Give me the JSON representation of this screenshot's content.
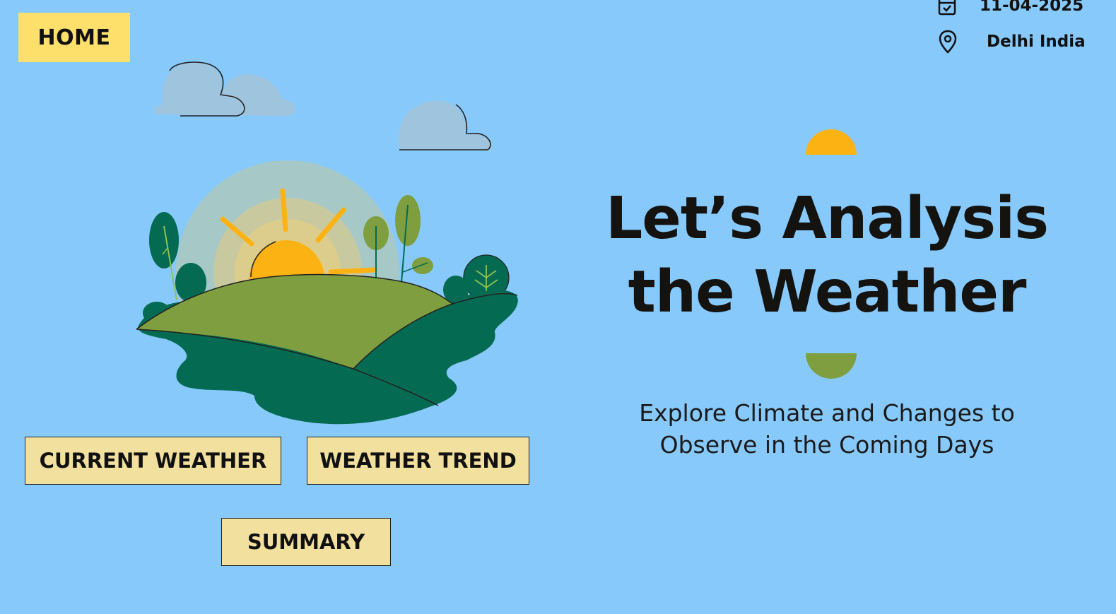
{
  "header": {
    "home_label": "HOME",
    "date": "11-04-2025",
    "location": "Delhi India",
    "date_icon": "calendar-check-icon",
    "location_icon": "map-pin-icon"
  },
  "hero": {
    "title_line1": "Let’s Analysis",
    "title_line2": "the Weather",
    "subtitle_line1": "Explore Climate and Changes to",
    "subtitle_line2": "Observe in the Coming Days"
  },
  "nav": {
    "current_weather": "CURRENT WEATHER",
    "weather_trend": "WEATHER TREND",
    "summary": "SUMMARY"
  },
  "colors": {
    "background": "#87c9fb",
    "home_button": "#fde06b",
    "nav_button": "#f2e09e",
    "sun": "#fdb214",
    "hill_light": "#7e9e3f",
    "hill_dark": "#046b52"
  }
}
